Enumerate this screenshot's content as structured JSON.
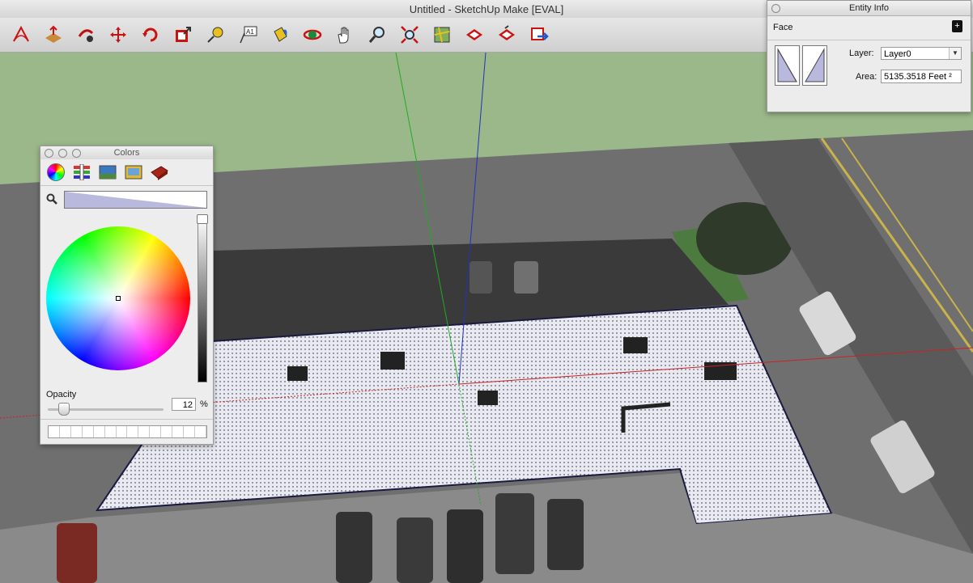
{
  "window": {
    "title": "Untitled - SketchUp Make [EVAL]"
  },
  "toolbar": {
    "tools": [
      {
        "name": "select-tool-icon"
      },
      {
        "name": "push-pull-tool-icon"
      },
      {
        "name": "follow-me-tool-icon"
      },
      {
        "name": "move-tool-icon"
      },
      {
        "name": "rotate-tool-icon"
      },
      {
        "name": "scale-tool-icon"
      },
      {
        "name": "tape-measure-tool-icon"
      },
      {
        "name": "text-tool-icon",
        "text": "A1"
      },
      {
        "name": "paint-bucket-tool-icon"
      },
      {
        "name": "orbit-tool-icon"
      },
      {
        "name": "pan-tool-icon"
      },
      {
        "name": "zoom-tool-icon"
      },
      {
        "name": "zoom-extents-tool-icon"
      },
      {
        "name": "add-location-icon"
      },
      {
        "name": "get-models-icon"
      },
      {
        "name": "share-model-icon"
      },
      {
        "name": "extension-warehouse-icon"
      }
    ]
  },
  "entity_info": {
    "title": "Entity Info",
    "entity_type": "Face",
    "layer_label": "Layer:",
    "layer_value": "Layer0",
    "area_label": "Area:",
    "area_value": "5135.3518 Feet ²"
  },
  "colors_panel": {
    "title": "Colors",
    "tabs": [
      "color-wheel-icon",
      "color-sliders-icon",
      "color-palettes-icon",
      "image-palettes-icon",
      "crayons-icon"
    ],
    "opacity_label": "Opacity",
    "opacity_value": "12",
    "opacity_unit": "%",
    "opacity_level": 0.12,
    "selected_color": "#b9b9dd"
  },
  "colors": {
    "sky": "#9bb88a",
    "ground": "#6f6f6f",
    "roof_selection": "#e9e9f1",
    "axis_red": "#cc2222",
    "axis_green": "#22aa22",
    "axis_blue": "#2233bb"
  }
}
